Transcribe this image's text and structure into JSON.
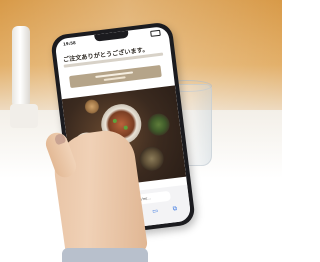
{
  "screen": {
    "status_time": "19:58",
    "heading": "ご注文ありがとうございます。",
    "url": "8 self-order.com/m/..."
  },
  "colors": {
    "wall": "#d89a48",
    "table": "#f7f4ef",
    "button": "#b5a489",
    "phone_frame": "#1b1b1f"
  },
  "icons": [
    "back-icon",
    "forward-icon",
    "share-icon",
    "bookmarks-icon",
    "tabs-icon"
  ]
}
